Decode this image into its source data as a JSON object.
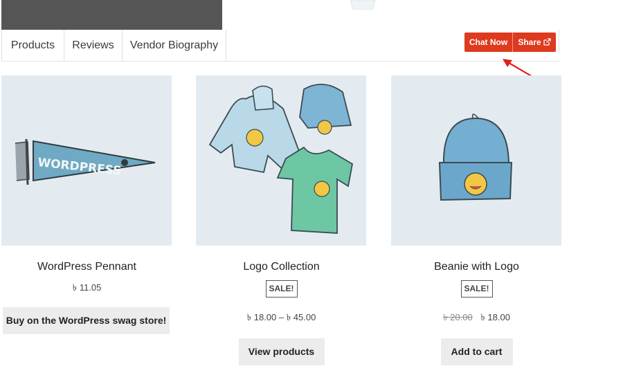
{
  "tabs": [
    {
      "label": "Products"
    },
    {
      "label": "Reviews"
    },
    {
      "label": "Vendor Biography"
    }
  ],
  "actions": {
    "chat_label": "Chat Now",
    "share_label": "Share"
  },
  "colors": {
    "accent": "#dd3a1e",
    "banner": "#555555",
    "thumb_bg": "#e3ebf1",
    "button_bg": "#ececec"
  },
  "products": [
    {
      "name": "WordPress Pennant",
      "sale_badge": "",
      "old_price": "",
      "price": "৳ 11.05",
      "cta": "Buy on the WordPress swag store!",
      "image_icon": "pennant-image"
    },
    {
      "name": "Logo Collection",
      "sale_badge": "SALE!",
      "old_price": "",
      "price": "৳ 18.00 – ৳ 45.00",
      "cta": "View products",
      "image_icon": "collection-image"
    },
    {
      "name": "Beanie with Logo",
      "sale_badge": "SALE!",
      "old_price": "৳ 20.00",
      "price": "৳ 18.00",
      "cta": "Add to cart",
      "image_icon": "beanie-image"
    }
  ]
}
